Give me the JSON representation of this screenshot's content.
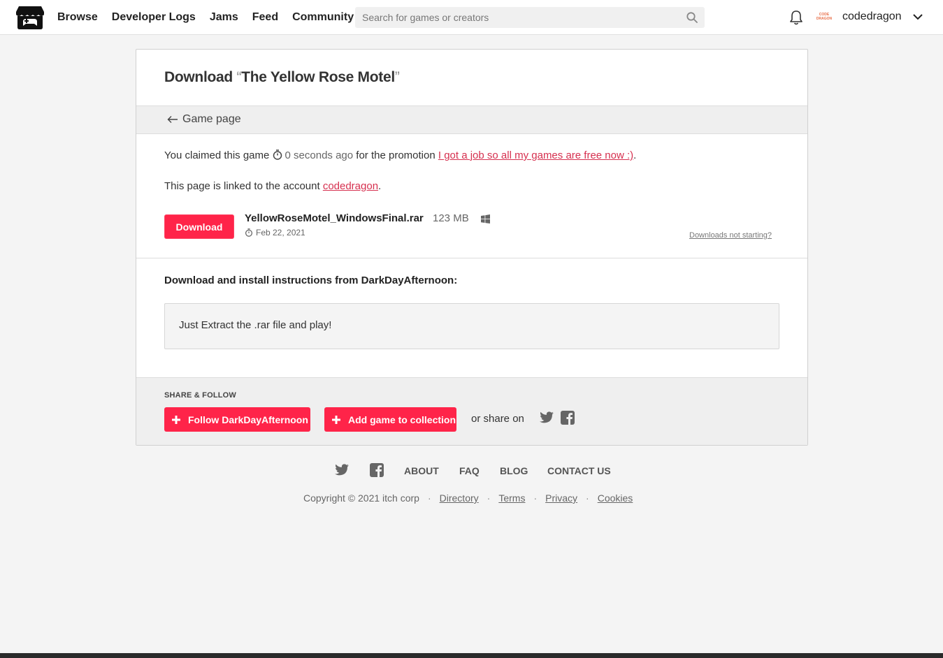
{
  "header": {
    "nav": [
      "Browse",
      "Developer Logs",
      "Jams",
      "Feed",
      "Community"
    ],
    "search_placeholder": "Search for games or creators",
    "avatar_text": "CODE DRAGON",
    "username": "codedragon"
  },
  "page": {
    "title_prefix": "Download ",
    "open_quote": "“",
    "game_title": "The Yellow Rose Motel",
    "close_quote": "”",
    "back_label": "Game page",
    "claim_prefix": "You claimed this game",
    "claim_time": "0 seconds ago",
    "claim_middle": " for the promotion ",
    "promotion_link": "I got a job so all my games are free now :)",
    "claim_suffix": ".",
    "linked_prefix": "This page is linked to the account ",
    "linked_account": "codedragon",
    "linked_suffix": "."
  },
  "upload": {
    "download_label": "Download",
    "file_name": "YellowRoseMotel_WindowsFinal.rar",
    "file_size": "123 MB",
    "platform_icon": "windows-icon",
    "date": "Feb 22, 2021",
    "not_starting": "Downloads not starting?"
  },
  "instructions": {
    "heading": "Download and install instructions from DarkDayAfternoon:",
    "text": "Just Extract the .rar file and play!"
  },
  "share": {
    "heading": "SHARE & FOLLOW",
    "follow_label": "Follow DarkDayAfternoon",
    "collection_label": "Add game to collection",
    "or_share": "or share on"
  },
  "footer": {
    "links": [
      "ABOUT",
      "FAQ",
      "BLOG",
      "CONTACT US"
    ],
    "copyright": "Copyright © 2021 itch corp",
    "legal": [
      "Directory",
      "Terms",
      "Privacy",
      "Cookies"
    ]
  },
  "colors": {
    "accent": "#ff2449",
    "link": "#d6304f"
  }
}
